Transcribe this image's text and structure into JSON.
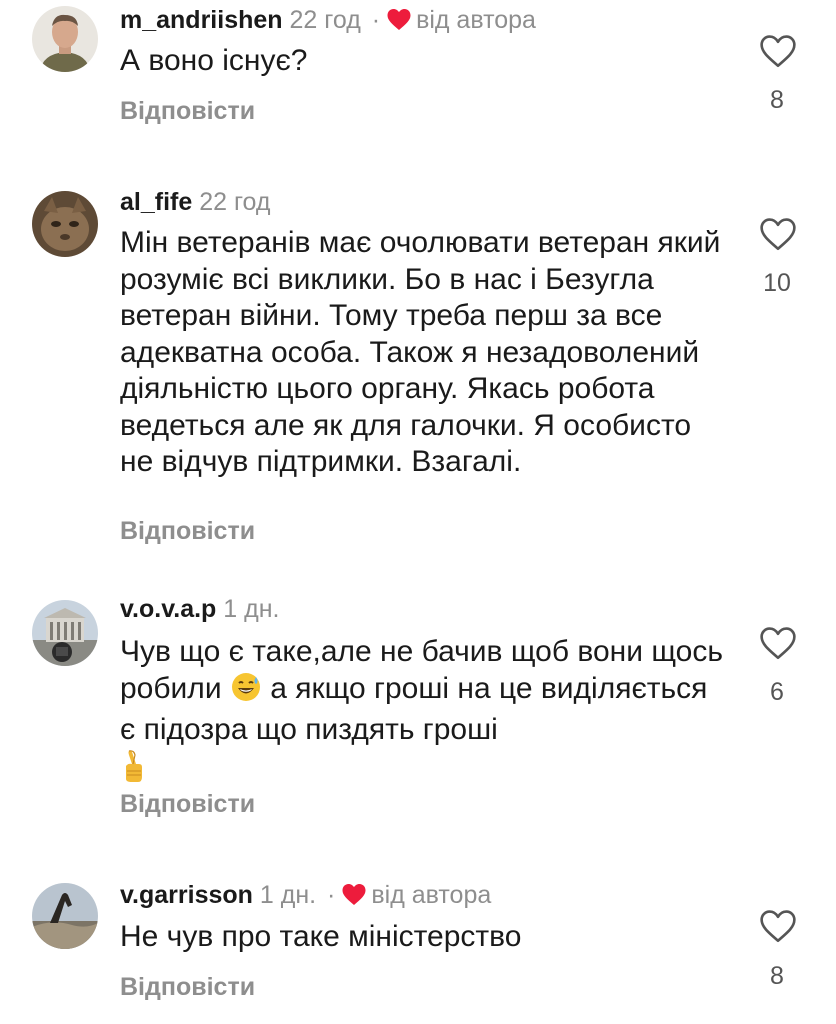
{
  "colors": {
    "heart_red": "#ed1c3c",
    "muted_text": "#8e8e8e",
    "primary_text": "#1a1a1a"
  },
  "comments": [
    {
      "username": "m_andriishen",
      "time": "22 год",
      "separator": "·",
      "author_like": "від автора",
      "text": "А воно існує?",
      "reply_label": "Відповісти",
      "likes": "8"
    },
    {
      "username": "al_fife",
      "time": "22 год",
      "text": "Мін ветеранів має очолювати ветеран який розуміє всі виклики. Бо в нас і Безугла ветеран війни. Тому треба перш за все адекватна особа. Також я незадоволений діяльністю цього органу. Якась робота ведеться але як для галочки. Я особисто не відчув підтримки. Взагалі.",
      "reply_label": "Відповісти",
      "likes": "10"
    },
    {
      "username": "v.o.v.a.p",
      "time": "1 дн.",
      "text_part1": "Чув що є таке,але не бачив щоб вони щось робили",
      "text_part2": "а якщо гроші на це виділяється є підозра що пиздять гроші",
      "emoji1": "grinning-sweat-emoji",
      "emoji2": "crossed-fingers-emoji",
      "reply_label": "Відповісти",
      "likes": "6"
    },
    {
      "username": "v.garrisson",
      "time": "1 дн.",
      "separator": "·",
      "author_like": "від автора",
      "text": "Не чув про таке міністерство",
      "reply_label": "Відповісти",
      "likes": "8"
    }
  ]
}
